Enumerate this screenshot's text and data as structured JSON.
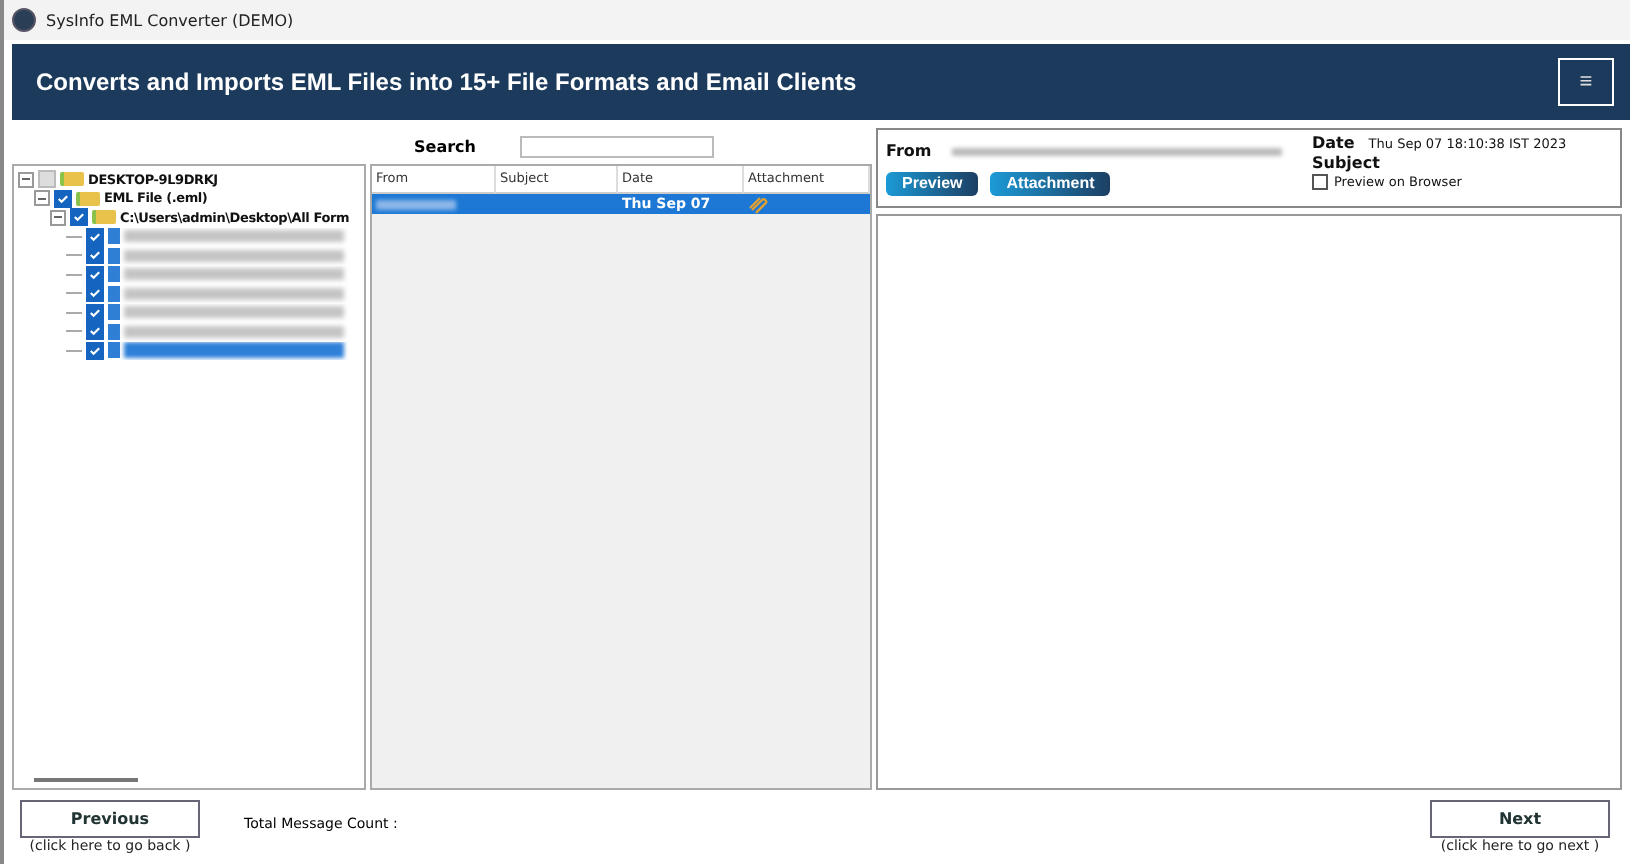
{
  "window": {
    "title": "SysInfo EML Converter (DEMO)"
  },
  "header": {
    "title": "Converts and Imports EML Files into 15+ File Formats and Email Clients",
    "menu_button": "≡"
  },
  "search": {
    "label": "Search"
  },
  "tree": [
    {
      "label": "DESKTOP-9L9DRKJ",
      "checked": false,
      "expanded": true,
      "children": [
        {
          "label": "EML File (.eml)",
          "checked": true,
          "expanded": true,
          "children": [
            {
              "label": "C:\\Users\\admin\\Desktop\\All Form",
              "checked": true,
              "expanded": true,
              "children": [
                {
                  "kind": "blurred",
                  "checked": true,
                  "selected": false
                },
                {
                  "kind": "blurred",
                  "checked": true,
                  "selected": false
                },
                {
                  "kind": "blurred",
                  "checked": true,
                  "selected": false
                },
                {
                  "kind": "blurred",
                  "checked": true,
                  "selected": false
                },
                {
                  "kind": "blurred",
                  "checked": true,
                  "selected": false
                },
                {
                  "kind": "blurred",
                  "checked": true,
                  "selected": false
                },
                {
                  "kind": "blurred",
                  "checked": true,
                  "selected": true
                }
              ]
            }
          ]
        }
      ]
    }
  ],
  "table": {
    "columns": [
      "From",
      "Subject",
      "Date",
      "Attachment"
    ],
    "rows": [
      {
        "date": "Thu Sep 07",
        "attachment": true,
        "selected": true
      }
    ]
  },
  "message": {
    "from_label": "From",
    "date_label": "Date",
    "date": "Thu Sep 07 18:10:38 IST 2023",
    "subject_label": "Subject",
    "buttons": [
      "Preview",
      "Attachment"
    ],
    "preview_on_browser": {
      "label": "Preview on Browser",
      "checked": false
    }
  },
  "footer": {
    "previous": "Previous",
    "previous_hint": "(click here to  go back )",
    "count_label": "Total Message Count :",
    "next": "Next",
    "next_hint": "(click here to  go next )"
  }
}
